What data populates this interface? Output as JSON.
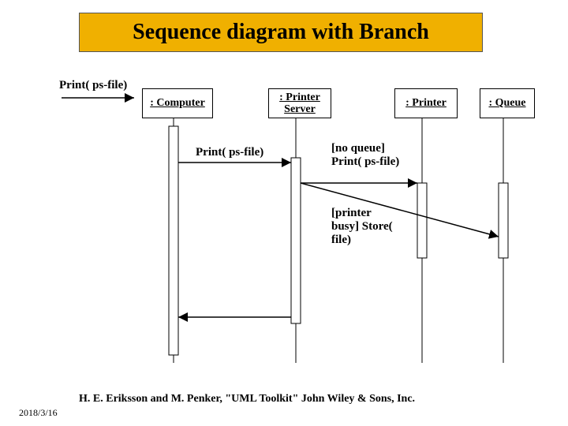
{
  "title": "Sequence diagram with Branch",
  "objects": {
    "computer": ": Computer",
    "printerServer": ": Printer\nServer",
    "printer": ": Printer",
    "queue": ": Queue"
  },
  "messages": {
    "start": "Print( ps-file)",
    "toServer": "Print( ps-file)",
    "branchPrint": "[no queue]\nPrint( ps-file)",
    "branchStore": "[printer\nbusy] Store(\nfile)"
  },
  "citation": "H. E. Eriksson and M. Penker, \"UML Toolkit\" John Wiley & Sons, Inc.",
  "date": "2018/3/16",
  "chart_data": {
    "type": "sequence-diagram",
    "lifelines": [
      "Computer",
      "Printer Server",
      "Printer",
      "Queue"
    ],
    "messages": [
      {
        "from": "external",
        "to": "Computer",
        "label": "Print( ps-file)"
      },
      {
        "from": "Computer",
        "to": "Printer Server",
        "label": "Print( ps-file)"
      },
      {
        "from": "Printer Server",
        "to": "Printer",
        "label": "[no queue] Print( ps-file)",
        "branch": true
      },
      {
        "from": "Printer Server",
        "to": "Queue",
        "label": "[printer busy] Store( file)",
        "branch": true
      },
      {
        "from": "Printer Server",
        "to": "Computer",
        "type": "return"
      }
    ]
  }
}
